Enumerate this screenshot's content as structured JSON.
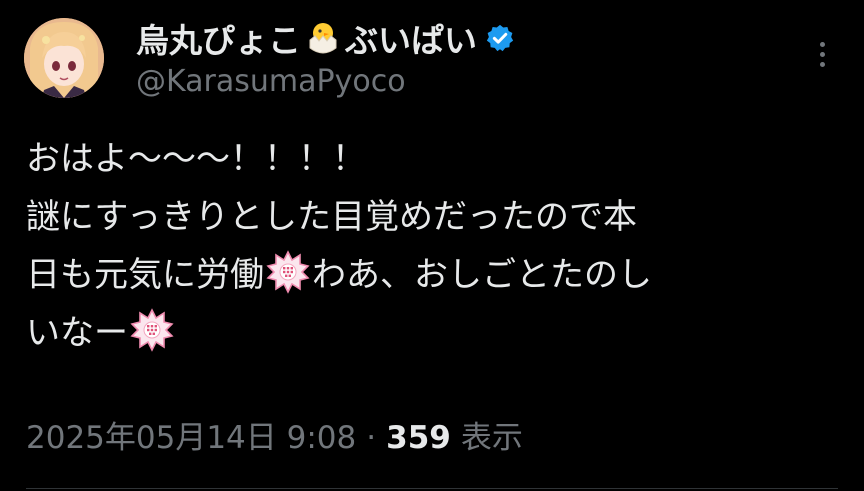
{
  "author": {
    "name_part1": "烏丸ぴょこ",
    "name_part2": "ぶいぱい",
    "name_emoji": "hatching-chick-emoji",
    "handle": "@KarasumaPyoco",
    "verified": true,
    "verified_color": "#1d9bf0"
  },
  "tweet": {
    "lines": [
      "おはよ〜〜〜！！！！",
      "謎にすっきりとした目覚めだったので本",
      "日も元気に労働",
      "わあ、おしごとたのし",
      "いなー"
    ],
    "emoji": "white-flower-emoji"
  },
  "meta": {
    "date_time": "2025年05月14日 9:08",
    "separator": "·",
    "views_count": "359",
    "views_label": "表示"
  },
  "colors": {
    "background": "#000000",
    "primary_text": "#e7e9ea",
    "secondary_text": "#71767b",
    "flower_pink": "#f4a6c0"
  },
  "icons": {
    "more": "more-vertical-icon",
    "verified": "verified-badge-icon"
  }
}
